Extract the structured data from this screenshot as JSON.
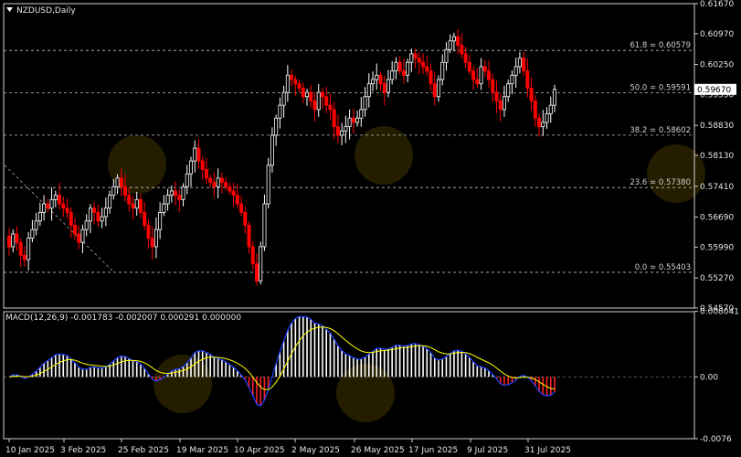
{
  "title": "NZDUSD,Daily",
  "macd_label": "MACD(12,26,9) -0.001783 -0.002007 0.000291 0.000000",
  "current_price": "0.59670",
  "colors": {
    "background": "#000000",
    "up": "#ffffff",
    "down": "#ff0000",
    "grid": "#c0c0c0",
    "macd_line": "#1f3fff",
    "signal_line": "#ffff00"
  },
  "chart_data": [
    {
      "type": "candlestick",
      "symbol": "NZDUSD",
      "timeframe": "Daily",
      "ylim": [
        0.5457,
        0.6167
      ],
      "y_ticks": [
        "0.61670",
        "0.60970",
        "0.60250",
        "0.59550",
        "0.58830",
        "0.58130",
        "0.57410",
        "0.56690",
        "0.55990",
        "0.55270",
        "0.54570"
      ],
      "x_ticks": [
        "10 Jan 2025",
        "3 Feb 2025",
        "25 Feb 2025",
        "19 Mar 2025",
        "10 Apr 2025",
        "2 May 2025",
        "26 May 2025",
        "17 Jun 2025",
        "9 Jul 2025",
        "31 Jul 2025"
      ],
      "fibonacci": [
        {
          "label": "61.8 = 0.60579",
          "value": 0.60579
        },
        {
          "label": "50.0 = 0.59591",
          "value": 0.59591
        },
        {
          "label": "38.2 = 0.58602",
          "value": 0.58602
        },
        {
          "label": "23.6 = 0.57380",
          "value": 0.5738
        },
        {
          "label": "0.0 = 0.55403",
          "value": 0.55403
        }
      ],
      "trendline": [
        [
          0.579,
          0.554
        ]
      ],
      "candles_close": [
        0.56,
        0.563,
        0.561,
        0.558,
        0.557,
        0.562,
        0.564,
        0.566,
        0.568,
        0.57,
        0.569,
        0.571,
        0.572,
        0.57,
        0.569,
        0.568,
        0.565,
        0.563,
        0.561,
        0.564,
        0.566,
        0.569,
        0.568,
        0.566,
        0.567,
        0.569,
        0.572,
        0.574,
        0.576,
        0.574,
        0.572,
        0.57,
        0.569,
        0.571,
        0.568,
        0.565,
        0.562,
        0.56,
        0.564,
        0.568,
        0.57,
        0.572,
        0.573,
        0.572,
        0.571,
        0.574,
        0.577,
        0.58,
        0.583,
        0.58,
        0.578,
        0.576,
        0.575,
        0.574,
        0.576,
        0.575,
        0.574,
        0.573,
        0.572,
        0.57,
        0.568,
        0.565,
        0.56,
        0.556,
        0.552,
        0.56,
        0.57,
        0.579,
        0.586,
        0.59,
        0.593,
        0.596,
        0.6,
        0.599,
        0.598,
        0.597,
        0.595,
        0.596,
        0.594,
        0.592,
        0.596,
        0.595,
        0.593,
        0.592,
        0.588,
        0.586,
        0.587,
        0.588,
        0.59,
        0.589,
        0.59,
        0.592,
        0.595,
        0.598,
        0.599,
        0.6,
        0.598,
        0.596,
        0.599,
        0.601,
        0.603,
        0.601,
        0.6,
        0.603,
        0.605,
        0.604,
        0.603,
        0.602,
        0.601,
        0.598,
        0.595,
        0.599,
        0.603,
        0.606,
        0.608,
        0.609,
        0.607,
        0.605,
        0.603,
        0.601,
        0.599,
        0.598,
        0.602,
        0.601,
        0.599,
        0.596,
        0.594,
        0.592,
        0.595,
        0.598,
        0.6,
        0.602,
        0.604,
        0.601,
        0.597,
        0.594,
        0.59,
        0.588,
        0.589,
        0.591,
        0.593,
        0.5967
      ],
      "macd": {
        "ylim": [
          -0.0076,
          0.008
        ],
        "ticks": [
          "0.008041",
          "0.00",
          "-0.0076"
        ]
      }
    }
  ]
}
